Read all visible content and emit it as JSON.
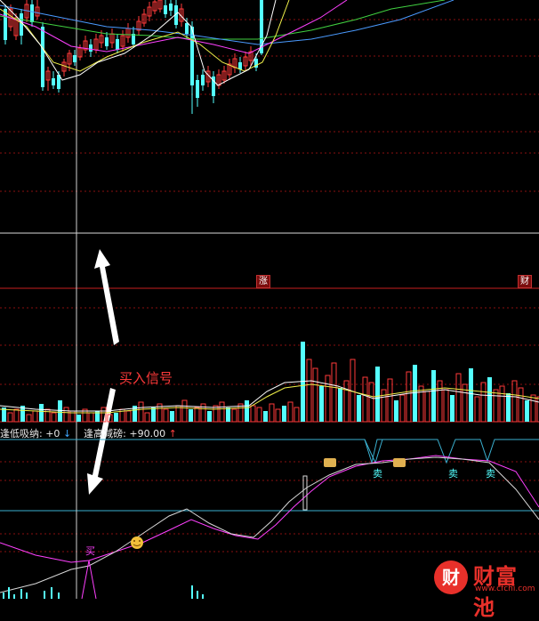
{
  "indicator": {
    "low_label": "逢低吸纳:",
    "low_value": "+0",
    "low_arrow": "↓",
    "high_label": "逢高减磅:",
    "high_value": "+90.00",
    "high_arrow": "↑"
  },
  "tags": {
    "rise": "涨",
    "wealth": "财"
  },
  "annotation": "买入信号",
  "signals": {
    "buy": "买",
    "sell": "卖"
  },
  "watermark": {
    "icon_char": "财",
    "name": "财富池",
    "url": "www.cfchi.com"
  },
  "colors": {
    "up": "#ff3a3a",
    "down": "#54ffff",
    "ma_white": "#ffffff",
    "ma_yellow": "#f0f04a",
    "ma_magenta": "#ff40ff",
    "ma_green": "#40d040",
    "ma_blue": "#4a9aff",
    "separator": "#c82020",
    "indicator_line": "#3ab0d0",
    "cursor": "#cfcfcf"
  }
}
